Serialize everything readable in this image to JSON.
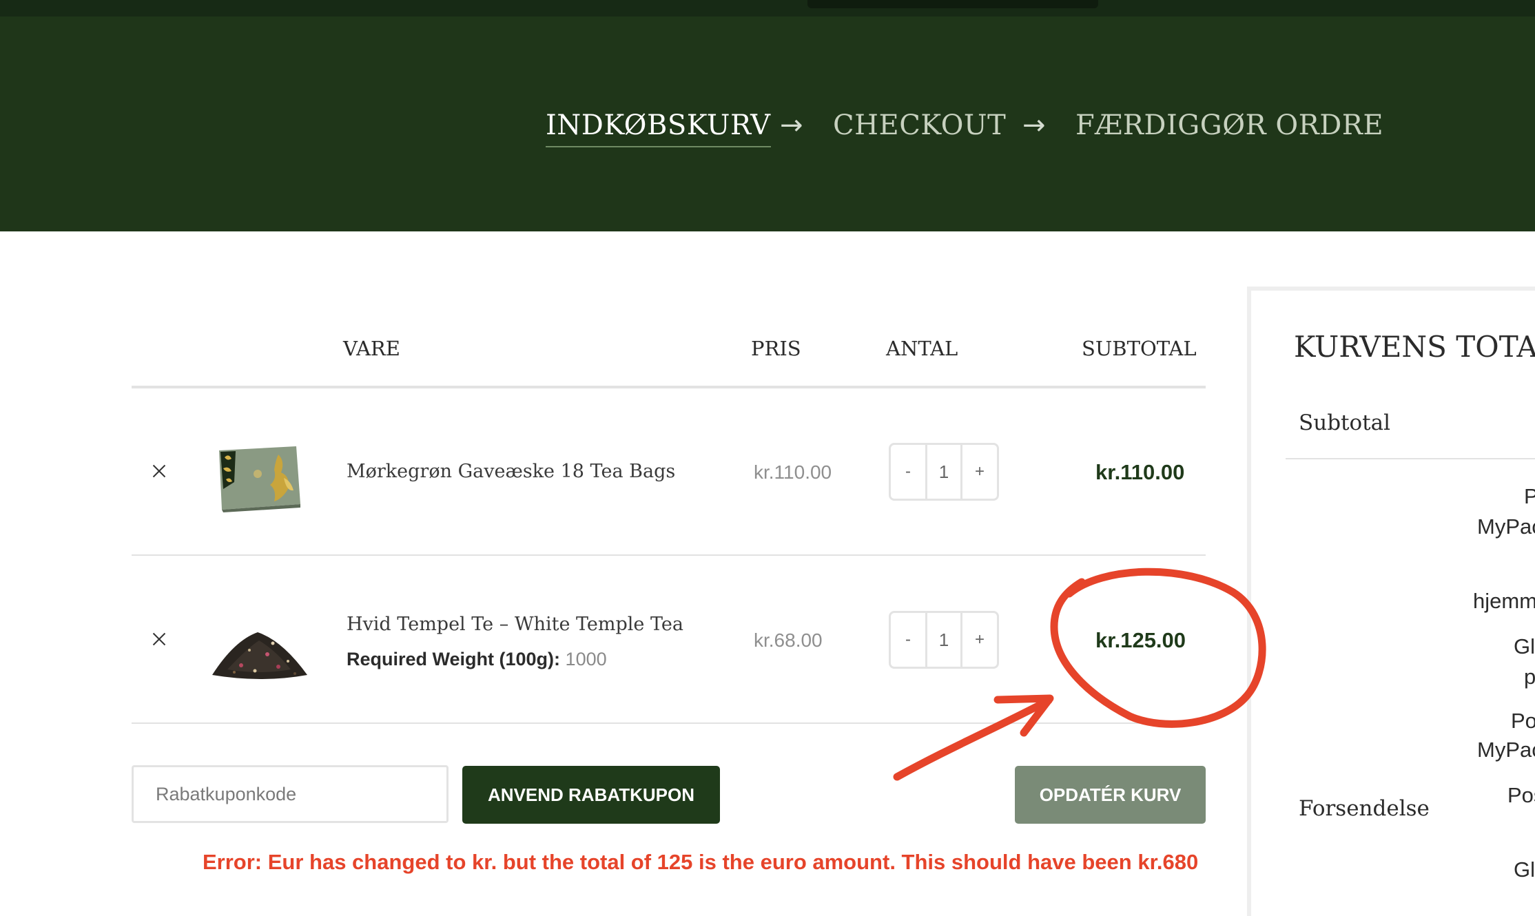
{
  "progress": {
    "steps": [
      "INDKØBSKURV",
      "CHECKOUT",
      "FÆRDIGGØR ORDRE"
    ],
    "separator": "→"
  },
  "cart_table": {
    "headers": {
      "product": "VARE",
      "price": "PRIS",
      "quantity": "ANTAL",
      "subtotal": "SUBTOTAL"
    },
    "rows": [
      {
        "name": "Mørkegrøn Gaveæske 18 Tea Bags",
        "price": "kr.110.00",
        "quantity": "1",
        "subtotal": "kr.110.00"
      },
      {
        "name": "Hvid Tempel Te – White Temple Tea",
        "meta_label": "Required Weight (100g):",
        "meta_value": "1000",
        "price": "kr.68.00",
        "quantity": "1",
        "subtotal": "kr.125.00"
      }
    ],
    "qty_minus": "-",
    "qty_plus": "+"
  },
  "coupon": {
    "placeholder": "Rabatkuponkode",
    "apply_label": "ANVEND RABATKUPON",
    "update_label": "OPDATÉR KURV"
  },
  "annotation": {
    "error_text": "Error: Eur has changed to kr. but the total of 125 is the euro amount. This should have been kr.680",
    "color": "#e6442a"
  },
  "cart_totals": {
    "title": "KURVENS TOTAL",
    "subtotal_label": "Subtotal",
    "shipping_label": "Forsendelse",
    "shipping_options_partial": [
      "P",
      "MyPac",
      "hjemm",
      "Gl",
      "p",
      "Po",
      "MyPac",
      "Pos",
      "Gl"
    ]
  },
  "colors": {
    "brand_dark_green": "#1f3619",
    "button_green": "#1f3a1a",
    "button_sage": "#7a8b77",
    "subtotal_text": "#1f3a1a"
  }
}
